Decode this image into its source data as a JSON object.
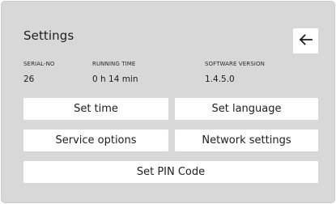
{
  "screen": {
    "title": "Settings"
  },
  "info": {
    "serial": {
      "label": "SERIAL-NO",
      "value": "26"
    },
    "running_time": {
      "label": "RUNNING TIME",
      "value": "0 h 14 min"
    },
    "software_version": {
      "label": "SOFTWARE VERSION",
      "value": "1.4.5.0"
    }
  },
  "buttons": {
    "set_time": "Set time",
    "set_language": "Set language",
    "service_options": "Service options",
    "network_settings": "Network settings",
    "set_pin_code": "Set PIN Code"
  },
  "icons": {
    "back": "arrow-left-icon"
  },
  "colors": {
    "panel_background": "#d8d8d8",
    "button_background": "#ffffff",
    "text": "#1d1d1d"
  }
}
